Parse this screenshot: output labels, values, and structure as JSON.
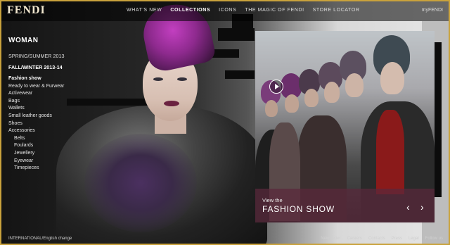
{
  "brand": {
    "logo": "FENDI"
  },
  "nav": {
    "items": [
      "WHAT'S NEW",
      "COLLECTIONS",
      "ICONS",
      "THE MAGIC OF FENDI",
      "STORE LOCATOR"
    ],
    "active_index": 1,
    "my_account": "myFENDI"
  },
  "menu": {
    "title": "WOMAN",
    "seasons": [
      "SPRING/SUMMER 2013",
      "FALL/WINTER 2013-14"
    ],
    "active_season": 1,
    "categories": [
      "Fashion show",
      "Ready to wear & Furwear",
      "Activewear",
      "Bags",
      "Wallets",
      "Small leather goods",
      "Shoes",
      "Accessories"
    ],
    "accessories_sub": [
      "Belts",
      "Foulards",
      "Jewellery",
      "Eyewear",
      "Timepieces"
    ]
  },
  "fashion_show": {
    "caption_small": "View the",
    "caption_big": "FASHION SHOW",
    "prev_icon": "chevron-left-icon",
    "next_icon": "chevron-right-icon",
    "play_icon": "play-icon"
  },
  "footer": {
    "locale": "INTERNATIONAL/English change",
    "links": [
      "Newsletter",
      "Careers",
      "Contacts",
      "Press",
      "Legal",
      "Follow us"
    ]
  },
  "colors": {
    "frame": "#c9a23c",
    "caption_bg": "#5a283c"
  }
}
